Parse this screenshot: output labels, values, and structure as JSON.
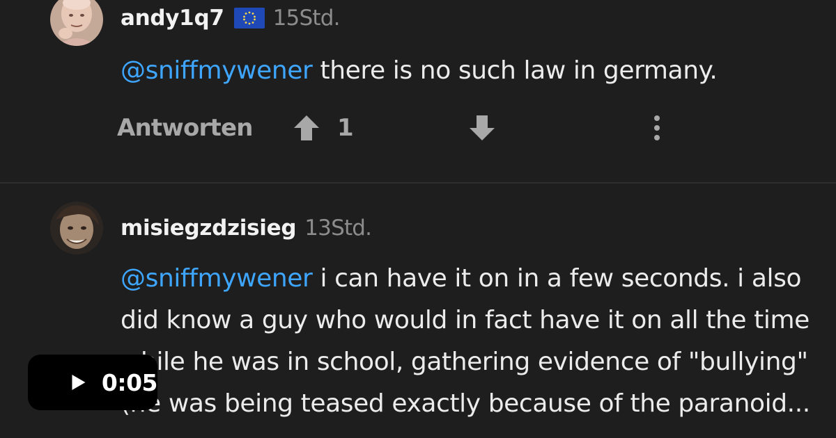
{
  "comments": [
    {
      "author": "andy1q7",
      "flag_icon": "eu-flag-icon",
      "time": "15Std.",
      "mention": "@sniffmywener",
      "text": " there is no such law in germany.",
      "reply_label": "Antworten",
      "score": "1"
    },
    {
      "author": "misiegzdzisieg",
      "time": "13Std.",
      "mention": "@sniffmywener",
      "text": " i can have it on in a few seconds. i also did know a guy who would in fact have it on all the time while he was in school, gathering evidence of \"bullying\"(he was being teased exactly because of the paranoid..."
    }
  ],
  "video": {
    "play_icon": "play-icon",
    "time": "0:05"
  },
  "colors": {
    "background": "#1e1e1e",
    "mention": "#3ea6ff",
    "muted": "#a8a8a8",
    "timestamp": "#8c8c8c",
    "player_pill": "#000000"
  }
}
